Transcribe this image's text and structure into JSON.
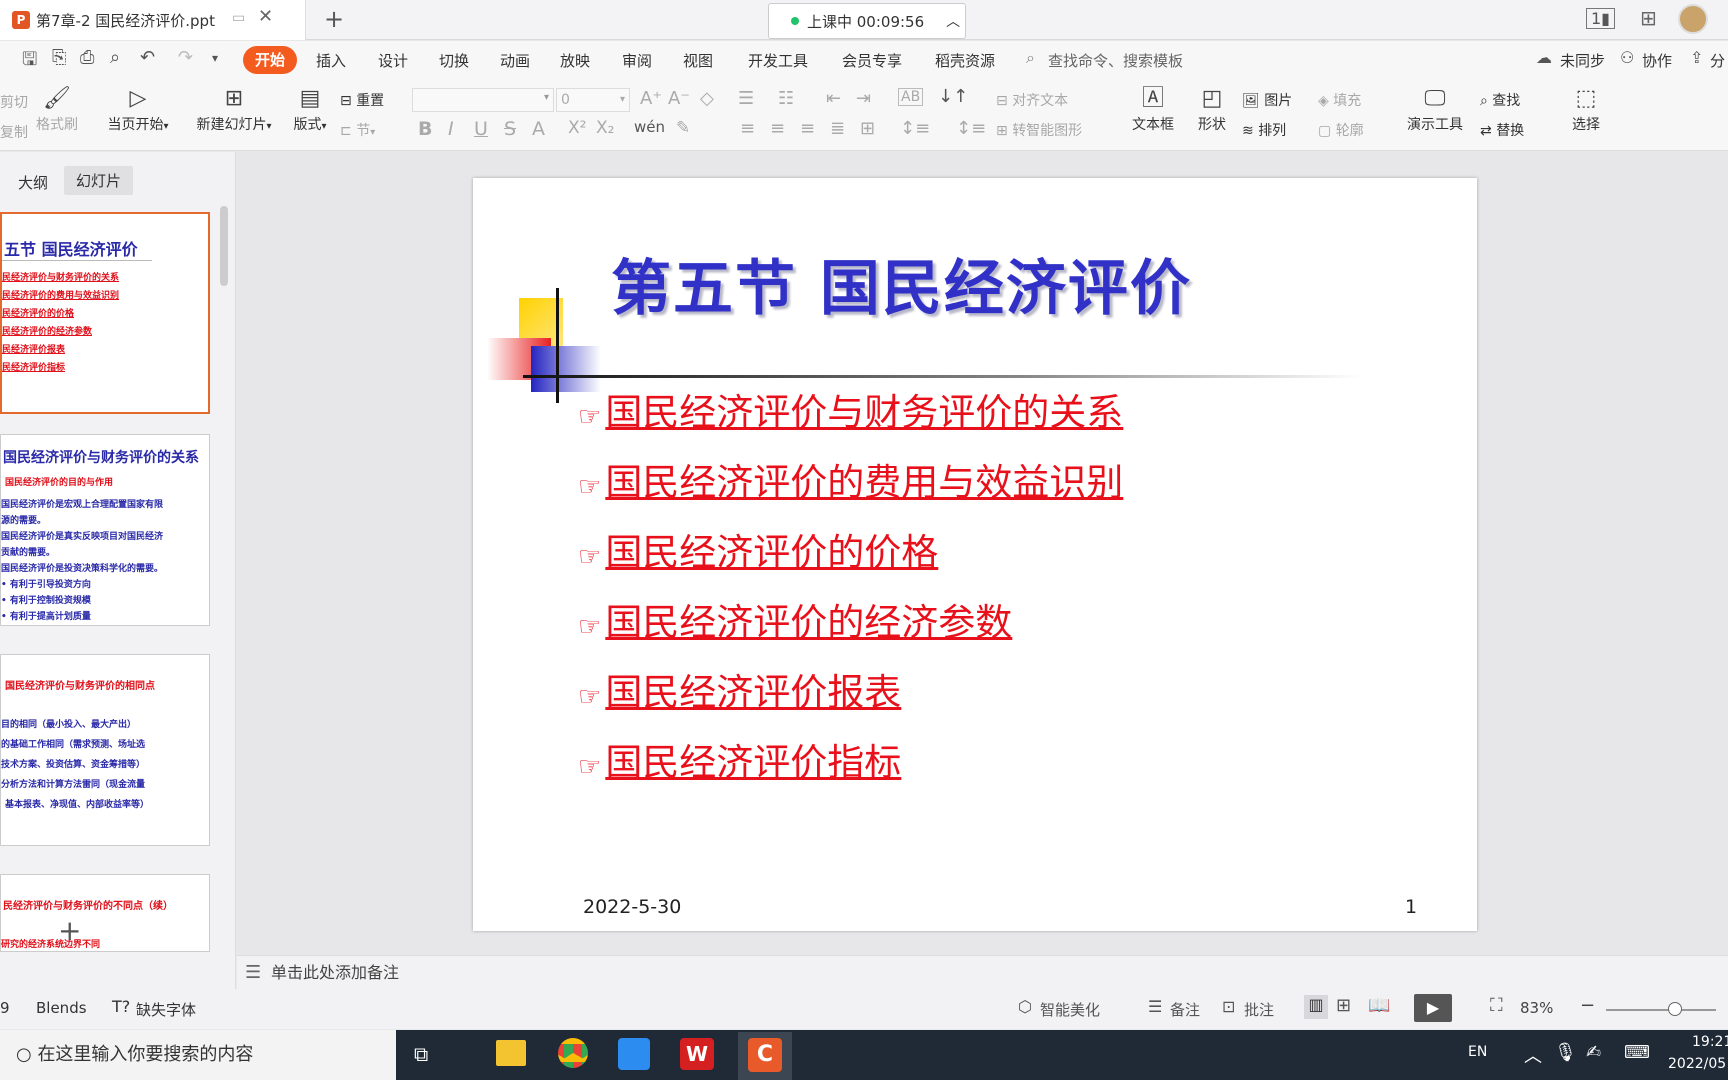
{
  "window": {
    "tab_title": "第7章-2  国民经济评价.ppt",
    "tab_icon": "P",
    "timer": "上课中 00:09:56"
  },
  "menu": {
    "items": [
      "开始",
      "插入",
      "设计",
      "切换",
      "动画",
      "放映",
      "审阅",
      "视图",
      "开发工具",
      "会员专享",
      "稻壳资源"
    ],
    "search": "查找命令、搜索模板",
    "sync": "未同步",
    "collab": "协作",
    "share": "分"
  },
  "ribbon": {
    "cut": "剪切",
    "copy": "复制",
    "format_painter": "格式刷",
    "play_current": "当页开始",
    "new_slide": "新建幻灯片",
    "layout": "版式",
    "reset": "重置",
    "section": "节",
    "font_size": "0",
    "align_text": "对齐文本",
    "smart_shape": "转智能图形",
    "textbox": "文本框",
    "shape": "形状",
    "picture": "图片",
    "arrange": "排列",
    "fill": "填充",
    "outline": "轮廓",
    "presenter_tools": "演示工具",
    "find": "查找",
    "replace": "替换",
    "select": "选择"
  },
  "left_panel": {
    "tab_outline": "大纲",
    "tab_slides": "幻灯片",
    "thumbs": [
      {
        "title": "五节  国民经济评价",
        "lines": [
          "民经济评价与财务评价的关系",
          "民经济评价的费用与效益识别",
          "民经济评价的价格",
          "民经济评价的经济参数",
          "民经济评价报表",
          "民经济评价指标"
        ]
      },
      {
        "title": "国民经济评价与财务评价的关系",
        "lines": [
          "国民经济评价的目的与作用",
          "国民经济评价是宏观上合理配置国家有限",
          "源的需要。",
          "国民经济评价是真实反映项目对国民经济",
          "贡献的需要。",
          "国民经济评价是投资决策科学化的需要。",
          "• 有利于引导投资方向",
          "• 有利于控制投资规模",
          "• 有利于提高计划质量"
        ]
      },
      {
        "title": "国民经济评价与财务评价的相同点",
        "lines": [
          "目的相同（最小投入、最大产出）",
          "的基础工作相同（需求预测、场址选",
          "技术方案、投资估算、资金筹措等）",
          "分析方法和计算方法雷同（现金流量",
          "基本报表、净现值、内部收益率等）"
        ]
      },
      {
        "title": "民经济评价与财务评价的不同点（续）",
        "lines": [
          "研究的经济系统边界不同"
        ]
      }
    ]
  },
  "slide": {
    "title": "第五节  国民经济评价",
    "bullets": [
      "国民经济评价与财务评价的关系",
      "国民经济评价的费用与效益识别",
      "国民经济评价的价格",
      "国民经济评价的经济参数",
      "国民经济评价报表",
      "国民经济评价指标"
    ],
    "date": "2022-5-30",
    "page": "1"
  },
  "notes_placeholder": "单击此处添加备注",
  "status": {
    "slide_count": "9",
    "theme": "Blends",
    "missing_font": "缺失字体",
    "beautify": "智能美化",
    "notes": "备注",
    "comment": "批注",
    "zoom": "83%"
  },
  "taskbar": {
    "search": "在这里输入你要搜索的内容",
    "lang": "EN",
    "time": "19:21",
    "date": "2022/05"
  },
  "colors": {
    "accent": "#f45c1f",
    "title": "#3131c8",
    "link": "#e8101a"
  }
}
